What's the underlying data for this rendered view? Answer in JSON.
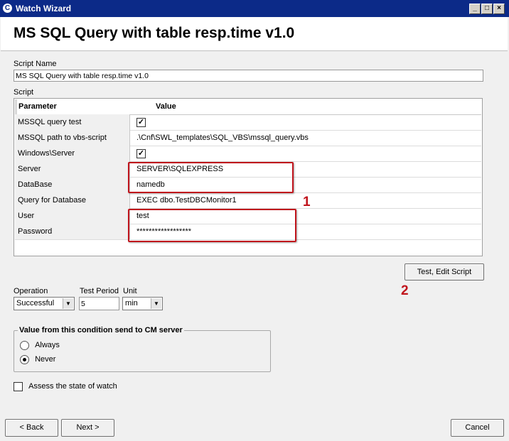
{
  "window": {
    "title": "Watch Wizard",
    "app_icon": "c-logo-icon",
    "controls": [
      "minimize-icon",
      "maximize-icon",
      "close-icon"
    ]
  },
  "header": {
    "title": "MS SQL Query with table resp.time v1.0"
  },
  "script_name": {
    "label": "Script Name",
    "value": "MS SQL Query with table resp.time v1.0"
  },
  "script": {
    "label": "Script",
    "columns": [
      "Parameter",
      "Value"
    ],
    "rows": [
      {
        "param": "MSSQL query test",
        "value": "",
        "checkbox": true
      },
      {
        "param": "MSSQL path to vbs-script",
        "value": ".\\Cnf\\SWL_templates\\SQL_VBS\\mssql_query.vbs"
      },
      {
        "param": "Windows\\Server authentification",
        "value": "",
        "checkbox": true
      },
      {
        "param": "Server",
        "value": "SERVER\\SQLEXPRESS"
      },
      {
        "param": "DataBase",
        "value": "namedb"
      },
      {
        "param": "Query for Database",
        "value": "EXEC dbo.TestDBCMonitor1"
      },
      {
        "param": "User",
        "value": "test"
      },
      {
        "param": "Password",
        "value": "******************"
      }
    ]
  },
  "annotations": {
    "one": "1",
    "two": "2"
  },
  "test_button": "Test, Edit Script",
  "operation": {
    "label": "Operation",
    "value": "Successful"
  },
  "test_period": {
    "label": "Test Period",
    "value": "5"
  },
  "unit": {
    "label": "Unit",
    "value": "min"
  },
  "condition_group": {
    "title": "Value from this condition send to CM server",
    "options": [
      "Always",
      "Never"
    ],
    "selected": "Never"
  },
  "assess": {
    "label": "Assess the state of watch",
    "checked": false
  },
  "footer": {
    "back": "< Back",
    "next": "Next >",
    "cancel": "Cancel"
  },
  "colors": {
    "titlebar": "#0c2a88",
    "annotation": "#c0141c"
  }
}
